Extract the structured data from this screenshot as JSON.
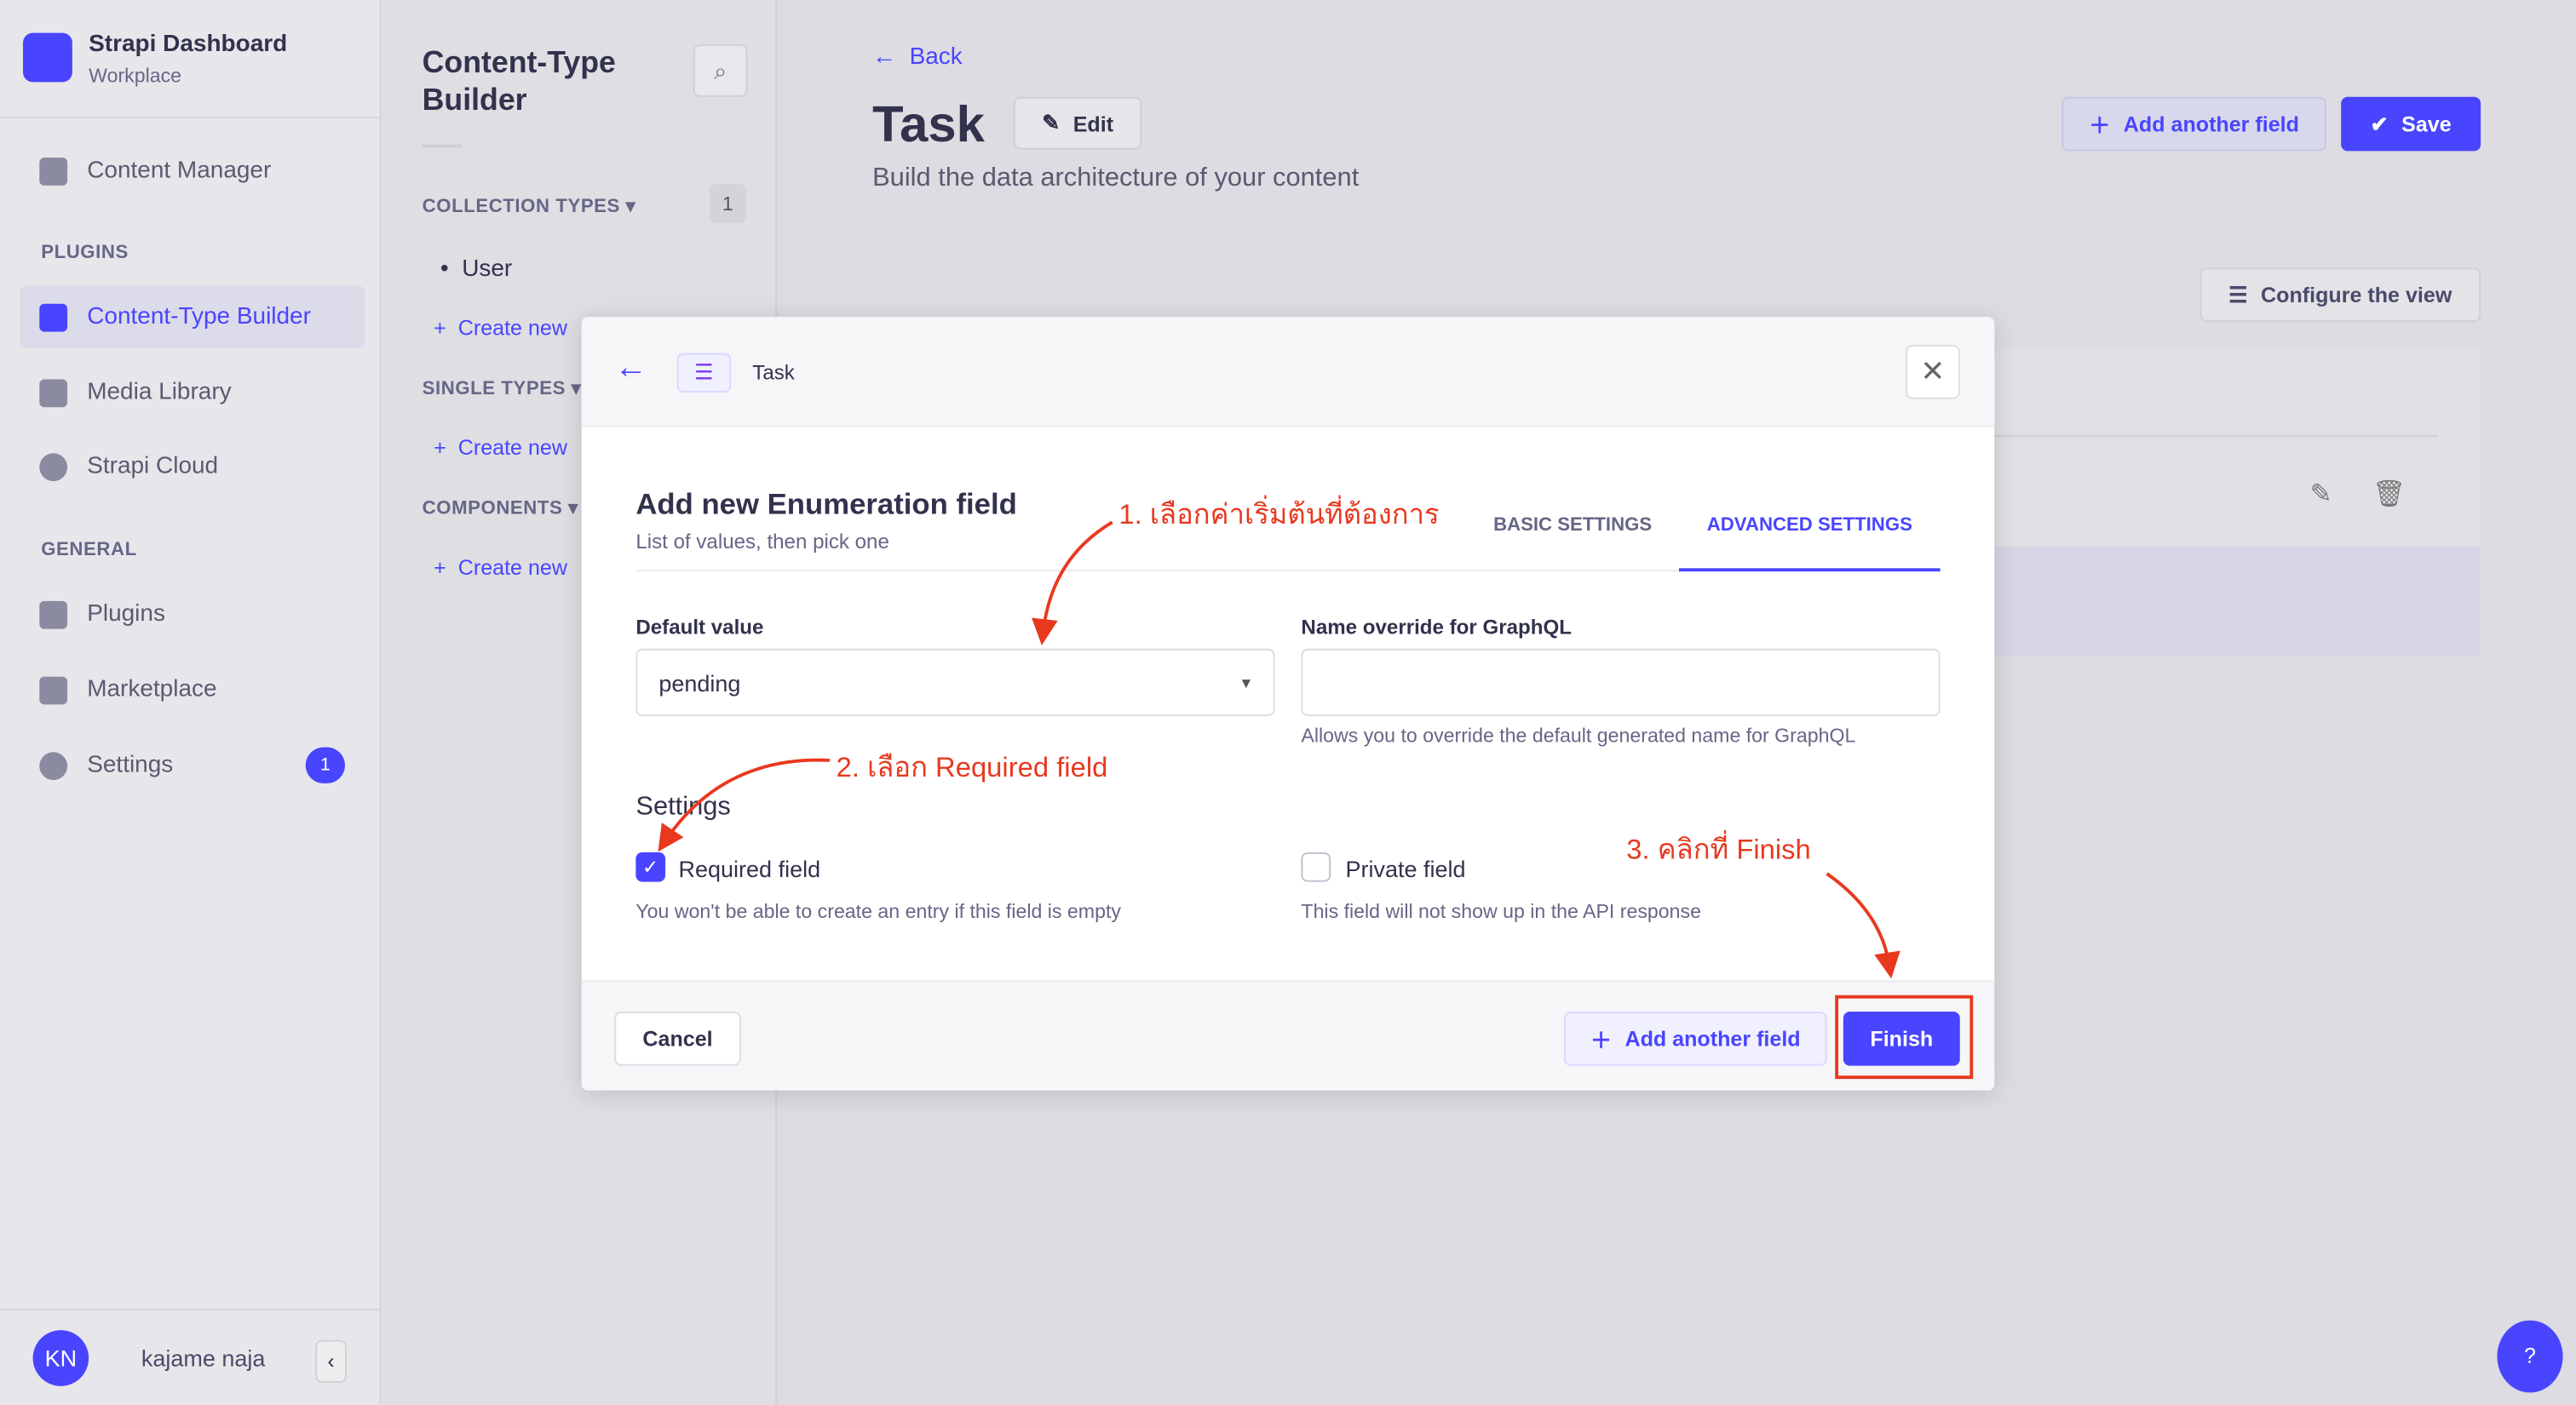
{
  "sidebar": {
    "brand_title": "Strapi Dashboard",
    "brand_subtitle": "Workplace",
    "items": [
      {
        "label": "Content Manager"
      },
      {
        "label": "Content-Type Builder"
      },
      {
        "label": "Media Library"
      },
      {
        "label": "Strapi Cloud"
      },
      {
        "label": "Plugins"
      },
      {
        "label": "Marketplace"
      },
      {
        "label": "Settings",
        "badge": "1"
      }
    ],
    "sections": {
      "plugins": "PLUGINS",
      "general": "GENERAL"
    },
    "user": {
      "initials": "KN",
      "name": "kajame naja"
    }
  },
  "subnav": {
    "title": "Content-Type Builder",
    "collection_types": "COLLECTION TYPES",
    "collection_count": "1",
    "collection_items": [
      "User"
    ],
    "create_new": "Create new",
    "single_types": "SINGLE TYPES",
    "components": "COMPONENTS"
  },
  "header": {
    "back": "Back",
    "title": "Task",
    "edit": "Edit",
    "subtitle": "Build the data architecture of your content",
    "add_another_field": "Add another field",
    "save": "Save",
    "configure_view": "Configure the view"
  },
  "modal": {
    "breadcrumb": "Task",
    "title": "Add new Enumeration field",
    "subtitle": "List of values, then pick one",
    "tabs": [
      {
        "label": "BASIC SETTINGS",
        "active": false
      },
      {
        "label": "ADVANCED SETTINGS",
        "active": true
      }
    ],
    "default_value_label": "Default value",
    "default_value": "pending",
    "graphql_label": "Name override for GraphQL",
    "graphql_value": "",
    "graphql_hint": "Allows you to override the default generated name for GraphQL",
    "settings_title": "Settings",
    "required": {
      "label": "Required field",
      "checked": true,
      "hint": "You won't be able to create an entry if this field is empty"
    },
    "private": {
      "label": "Private field",
      "checked": false,
      "hint": "This field will not show up in the API response"
    },
    "cancel": "Cancel",
    "add_another_field": "Add another field",
    "finish": "Finish"
  },
  "annotations": {
    "step1": "1. เลือกค่าเริ่มต้นที่ต้องการ",
    "step2": "2. เลือก Required field",
    "step3": "3. คลิกที่ Finish",
    "color": "#e8391f"
  },
  "help": "?",
  "colors": {
    "primary": "#4945ff"
  }
}
